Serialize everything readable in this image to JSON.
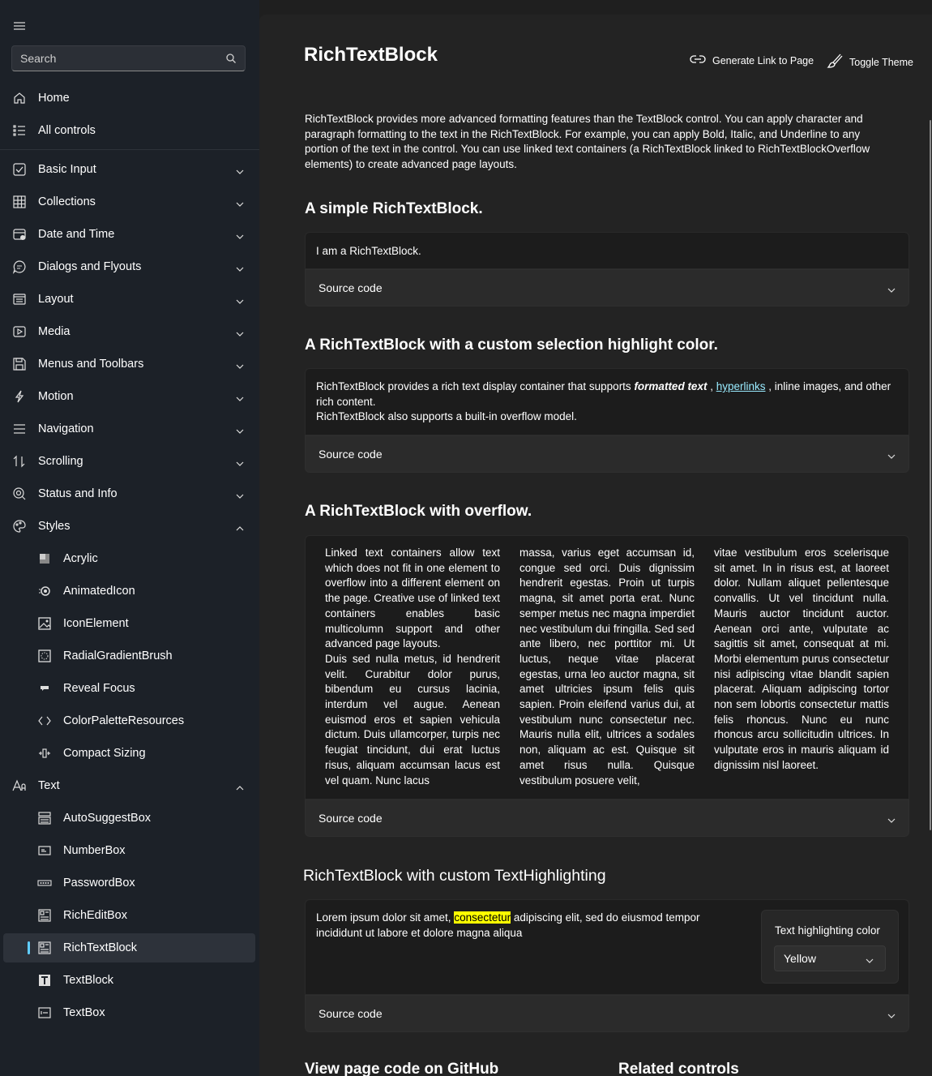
{
  "sidebar": {
    "search_placeholder": "Search",
    "items": [
      {
        "label": "Home",
        "icon": "home-icon"
      },
      {
        "label": "All controls",
        "icon": "list-icon"
      },
      {
        "label": "Basic Input",
        "icon": "checkbox-icon"
      },
      {
        "label": "Collections",
        "icon": "grid-icon"
      },
      {
        "label": "Date and Time",
        "icon": "calendar-icon"
      },
      {
        "label": "Dialogs and Flyouts",
        "icon": "chat-icon"
      },
      {
        "label": "Layout",
        "icon": "layout-icon"
      },
      {
        "label": "Media",
        "icon": "media-icon"
      },
      {
        "label": "Menus and Toolbars",
        "icon": "save-icon"
      },
      {
        "label": "Motion",
        "icon": "motion-icon"
      },
      {
        "label": "Navigation",
        "icon": "navigation-icon"
      },
      {
        "label": "Scrolling",
        "icon": "scroll-icon"
      },
      {
        "label": "Status and Info",
        "icon": "status-icon"
      },
      {
        "label": "Styles",
        "icon": "palette-icon"
      }
    ],
    "styles_children": [
      "Acrylic",
      "AnimatedIcon",
      "IconElement",
      "RadialGradientBrush",
      "Reveal Focus",
      "ColorPaletteResources",
      "Compact Sizing"
    ],
    "text_label": "Text",
    "text_children": [
      "AutoSuggestBox",
      "NumberBox",
      "PasswordBox",
      "RichEditBox",
      "RichTextBlock",
      "TextBlock",
      "TextBox"
    ],
    "selected": "RichTextBlock"
  },
  "header": {
    "title": "RichTextBlock",
    "generate_link": "Generate Link to Page",
    "toggle_theme": "Toggle Theme"
  },
  "intro": "RichTextBlock provides more advanced formatting features than the TextBlock control. You can apply character and paragraph formatting to the text in the RichTextBlock. For example, you can apply Bold, Italic, and Underline to any portion of the text in the control. You can use linked text containers (a RichTextBlock linked to RichTextBlockOverflow elements) to create advanced page layouts.",
  "sections": {
    "simple": {
      "title": "A simple RichTextBlock.",
      "text": "I am a RichTextBlock.",
      "source": "Source code"
    },
    "selection": {
      "title": "A RichTextBlock with a custom selection highlight color.",
      "p1_a": "RichTextBlock provides a rich text display container that supports ",
      "p1_bold": "formatted text",
      "p1_b": " , ",
      "p1_link": "hyperlinks",
      "p1_c": " , inline images, and other rich content.",
      "p2": "RichTextBlock also supports a built-in overflow model.",
      "source": "Source code"
    },
    "overflow": {
      "title": "A RichTextBlock with overflow.",
      "col1_p1": "Linked text containers allow text which does not fit in one element to overflow into a different element on the page. Creative use of linked text containers enables basic multicolumn support and other advanced page layouts.",
      "col1_p2": "Duis sed nulla metus, id hendrerit velit. Curabitur dolor purus, bibendum eu cursus lacinia, interdum vel augue. Aenean euismod eros et sapien vehicula dictum. Duis ullamcorper, turpis nec feugiat tincidunt, dui erat luctus risus, aliquam accumsan lacus est vel quam. Nunc lacus",
      "col2": "massa, varius eget accumsan id, congue sed orci. Duis dignissim hendrerit egestas. Proin ut turpis magna, sit amet porta erat. Nunc semper metus nec magna imperdiet nec vestibulum dui fringilla. Sed sed ante libero, nec porttitor mi. Ut luctus, neque vitae placerat egestas, urna leo auctor magna, sit amet ultricies ipsum felis quis sapien. Proin eleifend varius dui, at vestibulum nunc consectetur nec. Mauris nulla elit, ultrices a sodales non, aliquam ac est. Quisque sit amet risus nulla. Quisque vestibulum posuere velit,",
      "col3": "vitae vestibulum eros scelerisque sit amet. In in risus est, at laoreet dolor. Nullam aliquet pellentesque convallis. Ut vel tincidunt nulla. Mauris auctor tincidunt auctor. Aenean orci ante, vulputate ac sagittis sit amet, consequat at mi. Morbi elementum purus consectetur nisi adipiscing vitae blandit sapien placerat. Aliquam adipiscing tortor non sem lobortis consectetur mattis felis rhoncus. Nunc eu nunc rhoncus arcu sollicitudin ultrices. In vulputate eros in mauris aliquam id dignissim nisl laoreet.",
      "source": "Source code"
    },
    "highlighting": {
      "title": "RichTextBlock with custom TextHighlighting",
      "text_a": "Lorem ipsum dolor sit amet, ",
      "text_hl": "consectetur",
      "text_b": " adipiscing elit, sed do eiusmod tempor incididunt ut labore et dolore magna aliqua",
      "panel_label": "Text highlighting color",
      "selected_color": "Yellow",
      "highlight_color": "#ffff00",
      "source": "Source code"
    }
  },
  "footer": {
    "github": "View page code on GitHub",
    "related": "Related controls"
  },
  "colors": {
    "accent": "#60cdff",
    "link": "#99ebff"
  }
}
